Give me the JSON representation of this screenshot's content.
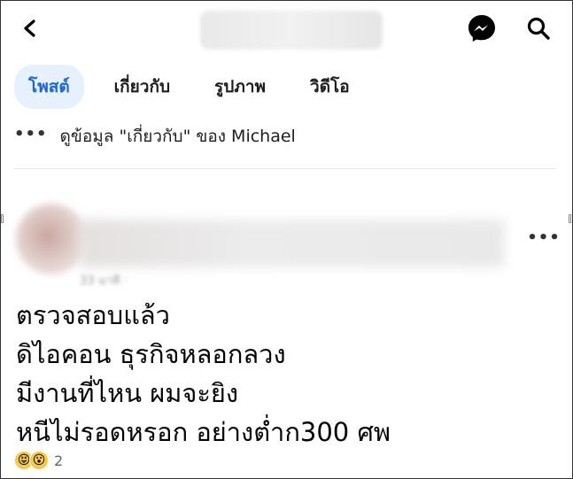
{
  "header": {
    "back_icon": "back-chevron-icon",
    "messenger_icon": "messenger-icon",
    "search_icon": "search-icon"
  },
  "tabs": [
    {
      "label": "โพสต์",
      "active": true
    },
    {
      "label": "เกี่ยวกับ",
      "active": false
    },
    {
      "label": "รูปภาพ",
      "active": false
    },
    {
      "label": "วิดีโอ",
      "active": false
    }
  ],
  "about_link": {
    "dots": "•••",
    "text": "ดูข้อมูล \"เกี่ยวกับ\" ของ Michael"
  },
  "post": {
    "meta": "33 นาที ·",
    "more": "•••",
    "lines": [
      "ตรวจสอบแล้ว",
      "ดิไอคอน ธุรกิจหลอกลวง",
      "มีงานที่ไหน ผมจะยิง",
      "หนีไม่รอดหรอก อย่างต่ำก300 ศพ"
    ],
    "reactions": {
      "emojis": [
        "😝",
        "😮"
      ],
      "count": "2"
    }
  },
  "colors": {
    "accent": "#1b66d6",
    "active_tab_bg": "#e7f0fd",
    "text": "#050505",
    "secondary": "#65676b"
  }
}
